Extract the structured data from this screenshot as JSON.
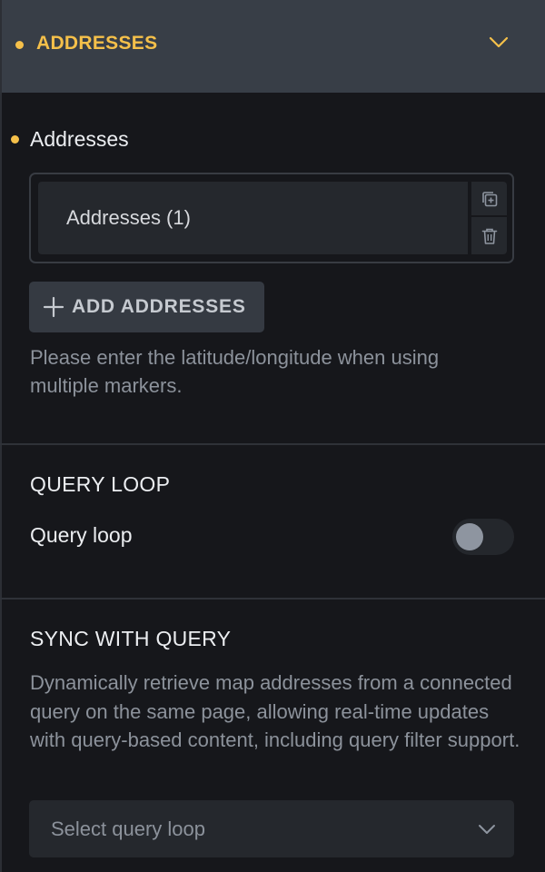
{
  "header": {
    "title": "ADDRESSES",
    "accent_color": "#f5c04a",
    "chevron_icon": "chevron-down-icon"
  },
  "addresses": {
    "label": "Addresses",
    "items": [
      {
        "label": "Addresses (1)",
        "actions": [
          "duplicate-icon",
          "trash-icon"
        ]
      }
    ],
    "add_button_label": "ADD ADDRESSES",
    "help_text": "Please enter the latitude/longitude when using multiple markers."
  },
  "query_loop": {
    "title": "QUERY LOOP",
    "toggle_label": "Query loop",
    "toggle_on": false
  },
  "sync_with_query": {
    "title": "SYNC WITH QUERY",
    "description": "Dynamically retrieve map addresses from a connected query on the same page, allowing real-time updates with query-based content, including query filter support.",
    "select_placeholder": "Select query loop"
  }
}
